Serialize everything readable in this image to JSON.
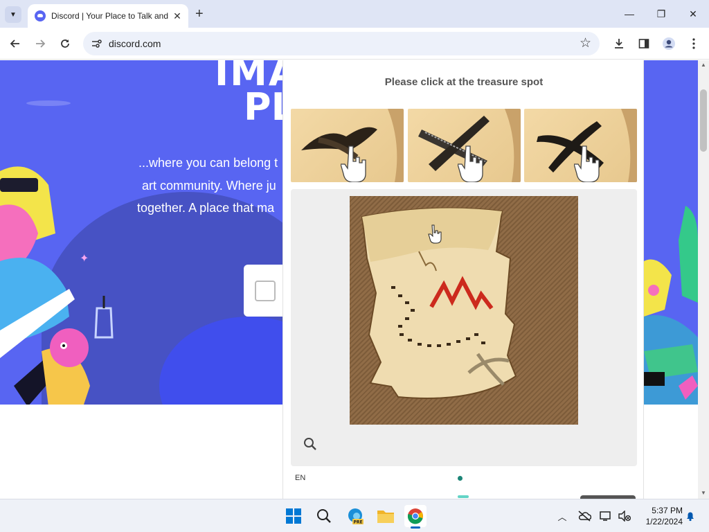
{
  "browser": {
    "tab_title": "Discord | Your Place to Talk and",
    "new_tab_symbol": "+",
    "url": "discord.com",
    "window_controls": {
      "minimize": "—",
      "maximize": "❐",
      "close": "✕"
    }
  },
  "page": {
    "headline_line1": "IMA",
    "headline_line2": "PL",
    "subtitle_lines": [
      "...where you can belong t",
      "art community. Where ju",
      "together. A place that ma"
    ],
    "brand_color": "#5865f2"
  },
  "captcha": {
    "prompt": "Please click at the treasure spot",
    "thumbnails": [
      "example-1",
      "example-2",
      "example-3"
    ],
    "language": "EN",
    "icons": {
      "zoom": "magnifier-icon"
    }
  },
  "taskbar": {
    "apps": [
      "start",
      "search",
      "edge-pre",
      "file-explorer",
      "chrome"
    ],
    "edge_badge": "PRE",
    "time": "5:37 PM",
    "date": "1/22/2024"
  }
}
